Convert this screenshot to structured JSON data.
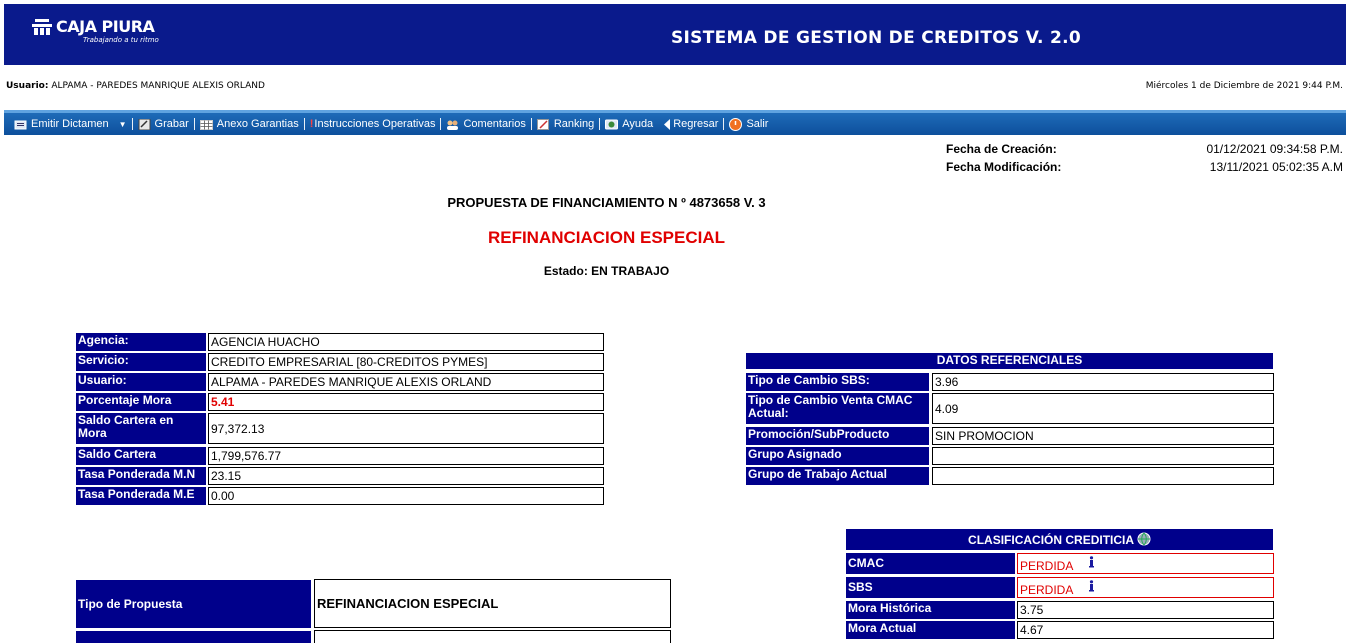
{
  "header": {
    "brand": "CAJA PIURA",
    "tagline": "Trabajando a tu ritmo",
    "system_title": "SISTEMA DE GESTION DE CREDITOS V. 2.0"
  },
  "user_bar": {
    "user_label": "Usuario:",
    "user_value": "ALPAMA - PAREDES MANRIQUE ALEXIS ORLAND",
    "date_text": "Miércoles 1 de Diciembre de 2021 9:44 P.M."
  },
  "toolbar": {
    "emitir": "Emitir Dictamen",
    "grabar": "Grabar",
    "anexo": "Anexo Garantias",
    "instrucciones": "Instrucciones Operativas",
    "comentarios": "Comentarios",
    "ranking": "Ranking",
    "ayuda": "Ayuda",
    "regresar": "Regresar",
    "salir": "Salir"
  },
  "dates": {
    "creacion_label": "Fecha de Creación:",
    "creacion_value": "01/12/2021 09:34:58 P.M.",
    "modificacion_label": "Fecha Modificación:",
    "modificacion_value": "13/11/2021 05:02:35 A.M"
  },
  "titles": {
    "propuesta": "PROPUESTA DE FINANCIAMIENTO N º 4873658 V. 3",
    "tipo": "REFINANCIACION ESPECIAL",
    "estado": "Estado: EN TRABAJO"
  },
  "left_info": [
    {
      "label": "Agencia:",
      "value": "AGENCIA HUACHO"
    },
    {
      "label": "Servicio:",
      "value": "CREDITO EMPRESARIAL [80-CREDITOS PYMES]"
    },
    {
      "label": "Usuario:",
      "value": "ALPAMA - PAREDES MANRIQUE ALEXIS ORLAND"
    },
    {
      "label": "Porcentaje Mora",
      "value": "5.41"
    },
    {
      "label": "Saldo Cartera en Mora",
      "value": "97,372.13"
    },
    {
      "label": "Saldo Cartera",
      "value": "1,799,576.77"
    },
    {
      "label": "Tasa Ponderada M.N",
      "value": "23.15"
    },
    {
      "label": "Tasa Ponderada M.E",
      "value": "0.00"
    }
  ],
  "datos_referenciales": {
    "title": "DATOS REFERENCIALES",
    "rows": [
      {
        "label": "Tipo de Cambio SBS:",
        "value": "3.96"
      },
      {
        "label": "Tipo de Cambio Venta CMAC Actual:",
        "value": "4.09"
      },
      {
        "label": "Promoción/SubProducto",
        "value": "SIN PROMOCION"
      },
      {
        "label": "Grupo Asignado",
        "value": ""
      },
      {
        "label": "Grupo de Trabajo Actual",
        "value": ""
      }
    ]
  },
  "clasificacion": {
    "title": "CLASIFICACIÓN CREDITICIA",
    "rows": [
      {
        "label": "CMAC",
        "value": "PERDIDA"
      },
      {
        "label": "SBS",
        "value": "PERDIDA"
      },
      {
        "label": "Mora Histórica",
        "value": "3.75"
      },
      {
        "label": "Mora Actual",
        "value": "4.67"
      }
    ]
  },
  "tipo_propuesta": {
    "label": "Tipo de Propuesta",
    "value": "REFINANCIACION ESPECIAL"
  },
  "colors": {
    "header_bg": "#0a1a8c",
    "label_bg": "#00008b",
    "toolbar_bg": "#0d4f9c",
    "alert": "#e00000"
  }
}
